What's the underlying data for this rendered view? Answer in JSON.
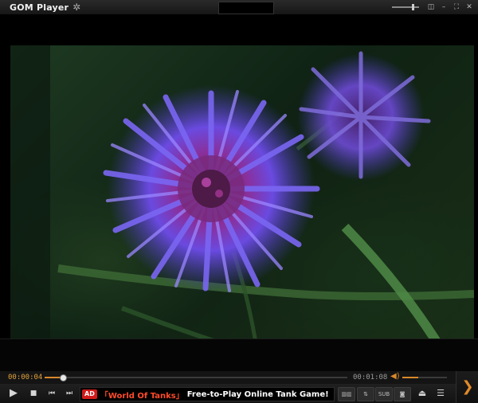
{
  "window": {
    "title": "GOM Player",
    "icons": {
      "settings": "gear-icon",
      "restore": "restore-icon",
      "fullscreen": "fullscreen-icon",
      "close": "close-icon"
    }
  },
  "player": {
    "current_time": "00:00:04",
    "total_time": "00:01:08",
    "progress": 0.06,
    "volume": 0.35
  },
  "ad": {
    "badge": "AD",
    "title": "「World Of Tanks」",
    "text": "Free-to-Play Online Tank Game!"
  },
  "tools": {
    "subtitle_label": "SUB"
  },
  "colors": {
    "accent": "#d8882a",
    "ad_red": "#d11a1a"
  }
}
